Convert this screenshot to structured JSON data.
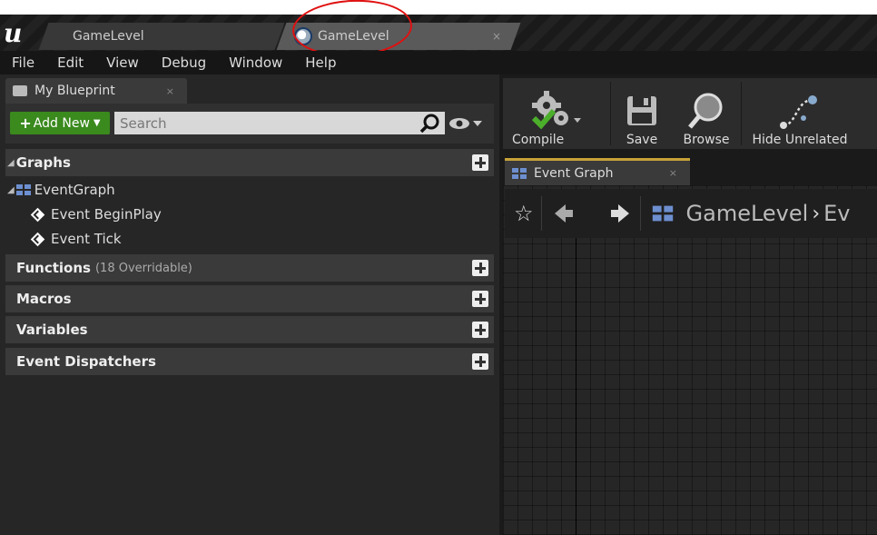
{
  "window": {
    "tabs": [
      {
        "label": "GameLevel"
      },
      {
        "label": "GameLevel",
        "close": "×"
      }
    ]
  },
  "menu": [
    "File",
    "Edit",
    "View",
    "Debug",
    "Window",
    "Help"
  ],
  "left_panel": {
    "tab_label": "My Blueprint",
    "tab_close": "×",
    "add_new_label": "Add New",
    "search_placeholder": "Search",
    "sections": {
      "graphs": "Graphs",
      "functions": "Functions",
      "functions_sub": "(18 Overridable)",
      "macros": "Macros",
      "variables": "Variables",
      "event_dispatchers": "Event Dispatchers"
    },
    "tree": {
      "event_graph": "EventGraph",
      "begin_play": "Event BeginPlay",
      "tick": "Event Tick"
    }
  },
  "toolbar": {
    "compile": "Compile",
    "save": "Save",
    "browse": "Browse",
    "hide_unrelated": "Hide Unrelated"
  },
  "graph": {
    "tab_label": "Event Graph",
    "tab_close": "×",
    "breadcrumb": "GameLevel",
    "breadcrumb_next": "Ev"
  },
  "colors": {
    "accent_add": "#3a8a1e",
    "tab_underline": "#c8a23a",
    "annotation": "#e01010"
  }
}
